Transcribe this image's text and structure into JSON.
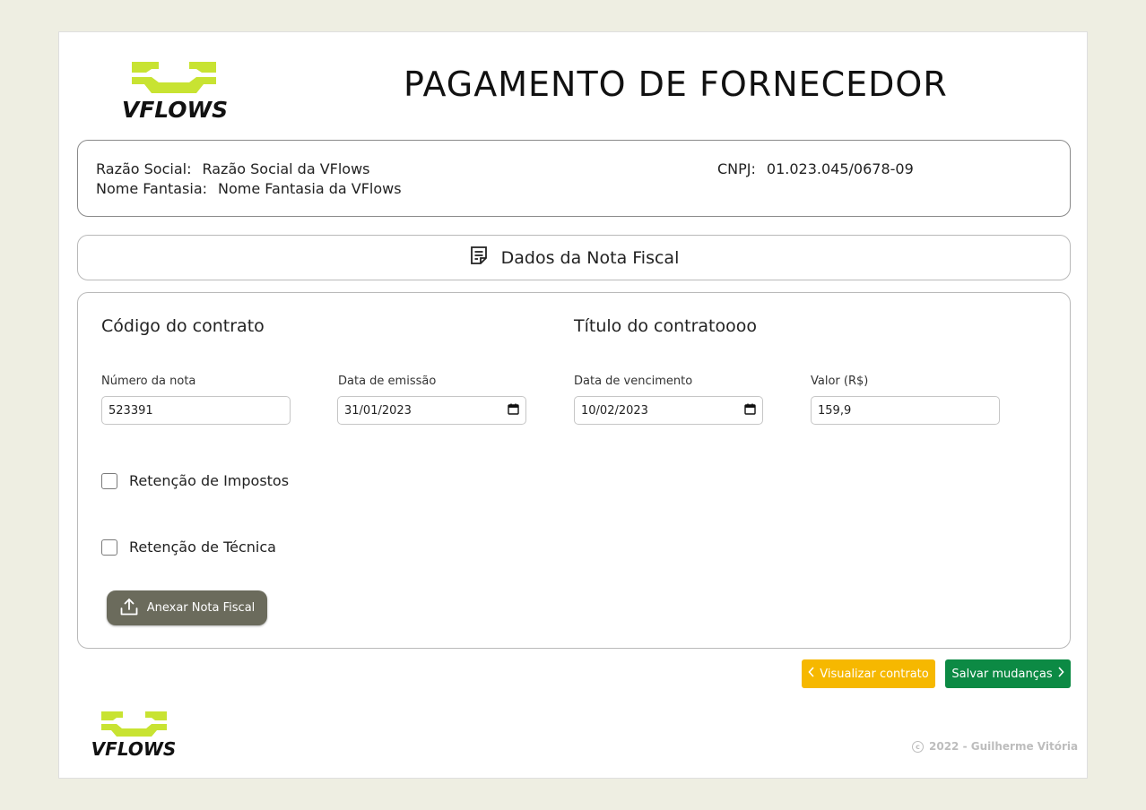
{
  "header": {
    "title": "PAGAMENTO DE FORNECEDOR",
    "logo_text": "VFLOWS"
  },
  "supplier": {
    "razao_label": "Razão Social:",
    "razao_value": "Razão Social da VFlows",
    "fantasia_label": "Nome Fantasia:",
    "fantasia_value": "Nome Fantasia da VFlows",
    "cnpj_label": "CNPJ:",
    "cnpj_value": "01.023.045/0678-09"
  },
  "section": {
    "title": "Dados da Nota Fiscal",
    "icon": "document-icon"
  },
  "form": {
    "contract_code": "Código do contrato",
    "contract_title": "Título do contratoooo",
    "numero_label": "Número da nota",
    "numero_value": "523391",
    "emissao_label": "Data de emissão",
    "emissao_value": "31/01/2023",
    "vencimento_label": "Data de vencimento",
    "vencimento_value": "10/02/2023",
    "valor_label": "Valor (R$)",
    "valor_value": "159,9",
    "retencao_impostos": "Retenção de Impostos",
    "retencao_tecnica": "Retenção de Técnica",
    "attach_label": "Anexar Nota Fiscal"
  },
  "actions": {
    "view_label": "Visualizar contrato",
    "save_label": "Salvar mudanças"
  },
  "footer": {
    "copyright": "2022 - Guilherme Vitória",
    "logo_text": "VFLOWS"
  },
  "colors": {
    "background": "#eeeee2",
    "logo_green": "#c8e332",
    "attach_button": "#6b6b5c",
    "view_button": "#f6b800",
    "save_button": "#0c8a44"
  }
}
